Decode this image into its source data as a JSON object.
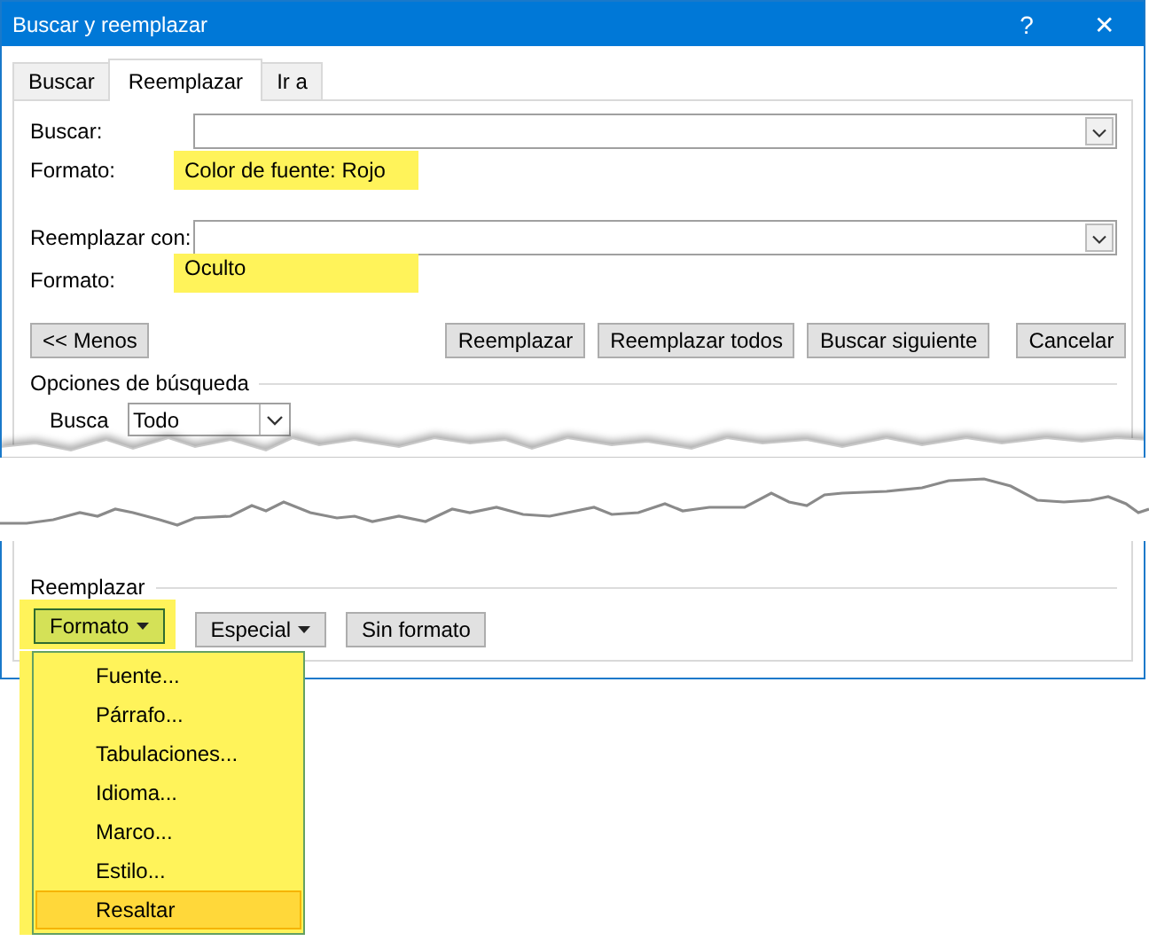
{
  "window": {
    "title": "Buscar y reemplazar",
    "buttons": [
      "?",
      "✕"
    ]
  },
  "tabs": [
    {
      "label": "Buscar",
      "selected": false
    },
    {
      "label": "Reemplazar",
      "selected": true
    },
    {
      "label": "Ir a",
      "selected": false
    }
  ],
  "fields": [
    {
      "label": "Buscar:",
      "format_label": "Formato:",
      "format": "Color de fuente: Rojo"
    },
    {
      "label": "Reemplazar con:",
      "format_label": "Formato:",
      "format": "Oculto"
    }
  ],
  "buttons": [
    {
      "label": "<< Menos"
    },
    {
      "label": "Reemplazar"
    },
    {
      "label": "Reemplazar todos"
    },
    {
      "label": "Buscar siguiente"
    },
    {
      "label": "Cancelar"
    }
  ],
  "search_options": {
    "title": "Opciones de búsqueda",
    "search_label": "Busca",
    "search_value": "Todo"
  },
  "replace_section": {
    "title": "Reemplazar",
    "buttons": [
      {
        "label": "Formato",
        "menu": true,
        "selected": true
      },
      {
        "label": "Especial",
        "menu": true,
        "selected": false
      },
      {
        "label": "Sin formato",
        "menu": false,
        "selected": false
      }
    ]
  },
  "format_menu": {
    "items": [
      {
        "label": "Fuente...",
        "selected": false
      },
      {
        "label": "Párrafo...",
        "selected": false
      },
      {
        "label": "Tabulaciones...",
        "selected": false
      },
      {
        "label": "Idioma...",
        "selected": false
      },
      {
        "label": "Marco...",
        "selected": false
      },
      {
        "label": "Estilo...",
        "selected": false
      },
      {
        "label": "Resaltar",
        "selected": true
      }
    ]
  }
}
